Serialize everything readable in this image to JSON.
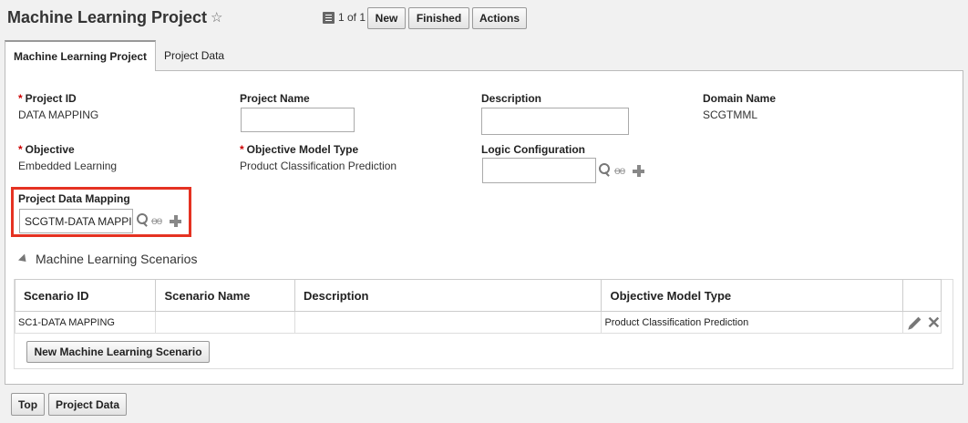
{
  "header": {
    "title": "Machine Learning Project",
    "star_icon": "☆",
    "pager_text": "1 of 1",
    "buttons": {
      "new": "New",
      "finished": "Finished",
      "actions": "Actions"
    }
  },
  "tabs": [
    {
      "label": "Machine Learning Project"
    },
    {
      "label": "Project Data"
    }
  ],
  "form": {
    "project_id": {
      "label": "Project ID",
      "value": "DATA MAPPING",
      "required": "*"
    },
    "project_name": {
      "label": "Project Name",
      "value": ""
    },
    "description": {
      "label": "Description",
      "value": ""
    },
    "domain_name": {
      "label": "Domain Name",
      "value": "SCGTMML"
    },
    "objective": {
      "label": "Objective",
      "value": "Embedded Learning",
      "required": "*"
    },
    "objective_model_type": {
      "label": "Objective Model Type",
      "value": "Product Classification Prediction",
      "required": "*"
    },
    "logic_configuration": {
      "label": "Logic Configuration",
      "value": ""
    },
    "project_data_mapping": {
      "label": "Project Data Mapping",
      "value": "SCGTM-DATA MAPPING"
    },
    "glasses_glyph": "oo"
  },
  "scenarios": {
    "title": "Machine Learning Scenarios",
    "columns": [
      "Scenario ID",
      "Scenario Name",
      "Description",
      "Objective Model Type"
    ],
    "rows": [
      {
        "scenario_id": "SC1-DATA MAPPING",
        "scenario_name": "",
        "description": "",
        "objective_model_type": "Product Classification Prediction"
      }
    ],
    "new_button": "New Machine Learning Scenario"
  },
  "footer": {
    "top_button": "Top",
    "project_data_button": "Project Data"
  },
  "colors": {
    "highlight": "#e53222",
    "required": "#cc0000"
  }
}
